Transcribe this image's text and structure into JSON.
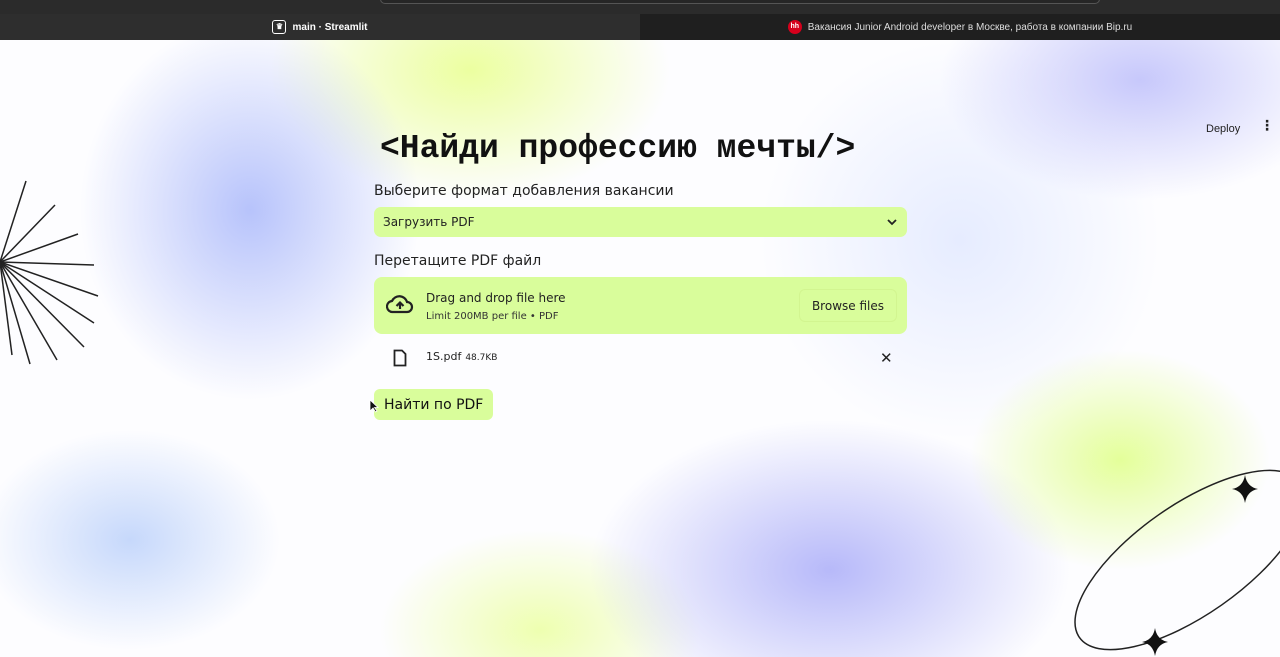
{
  "browser": {
    "tabs": [
      {
        "title": "main · Streamlit",
        "favicon": "streamlit-crown-icon",
        "active": true
      },
      {
        "title": "Вакансия Junior Android developer в Москве, работа в компании Bip.ru",
        "favicon": "hh-icon",
        "active": false
      }
    ],
    "hh_favicon_text": "hh"
  },
  "header": {
    "deploy_label": "Deploy",
    "menu_icon": "⋮"
  },
  "main": {
    "title": "<Найди профессию мечты/>",
    "format_label": "Выберите формат добавления вакансии",
    "format_selected": "Загрузить PDF",
    "upload_label": "Перетащите PDF файл",
    "dropzone": {
      "title": "Drag and drop file here",
      "hint": "Limit 200MB per file • PDF",
      "browse_label": "Browse files"
    },
    "uploaded_file": {
      "name": "1S.pdf",
      "size": "48.7KB"
    },
    "submit_label": "Найти по PDF"
  },
  "colors": {
    "accent": "#d9fd9b",
    "text": "#222222"
  }
}
